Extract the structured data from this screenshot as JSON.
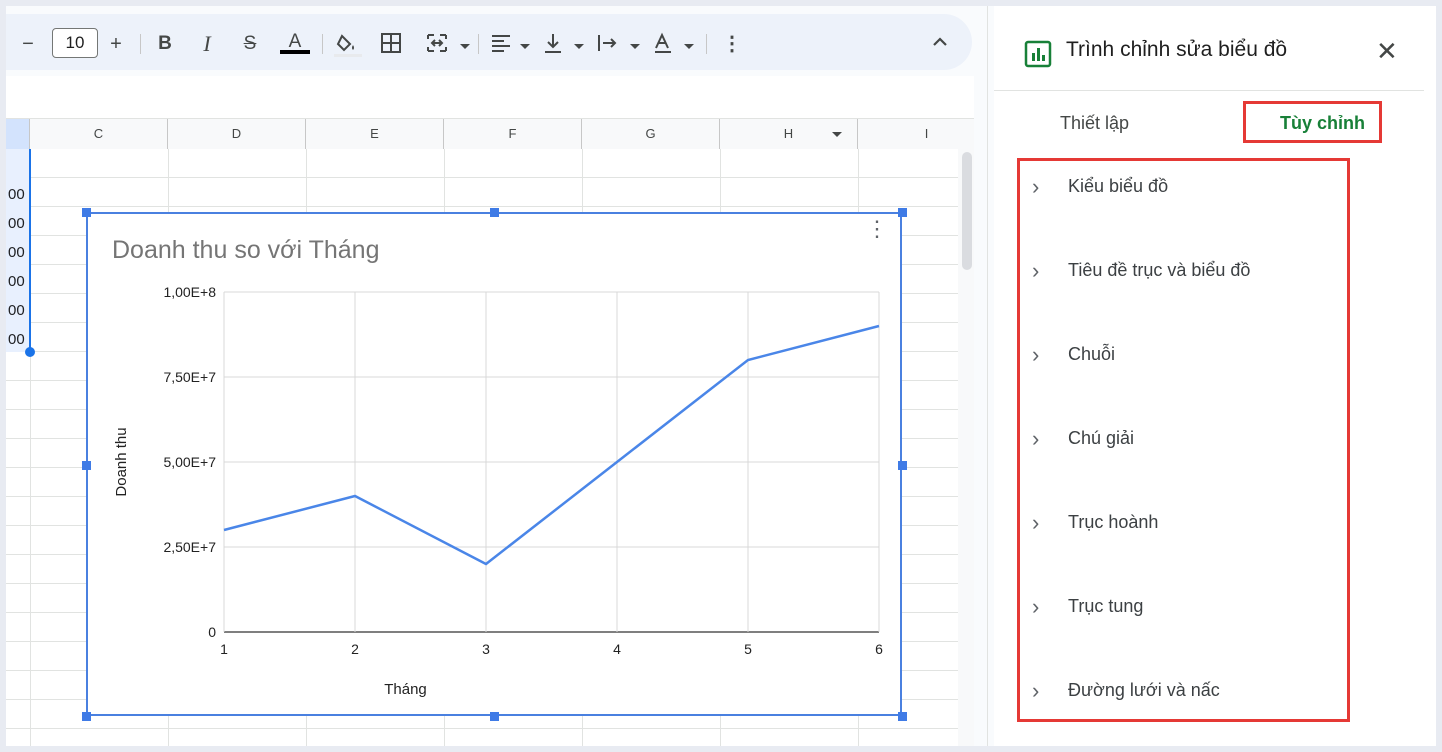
{
  "toolbar": {
    "font_size": "10",
    "decrease": "−",
    "increase": "+",
    "bold": "B",
    "italic": "I",
    "strike": "S",
    "text_color": "A",
    "more": "⋮",
    "collapse": "^"
  },
  "columns": [
    "C",
    "D",
    "E",
    "F",
    "G",
    "H",
    "I"
  ],
  "cell_values": [
    "00",
    "00",
    "00",
    "00",
    "00",
    "00"
  ],
  "chart_data": {
    "type": "line",
    "title": "Doanh thu  so với Tháng",
    "xlabel": "Tháng",
    "ylabel": "Doanh thu",
    "x": [
      1,
      2,
      3,
      4,
      5,
      6
    ],
    "x_tick_labels": [
      "1",
      "2",
      "3",
      "4",
      "5",
      "6"
    ],
    "y_tick_labels": [
      "0",
      "2,50E+7",
      "5,00E+7",
      "7,50E+7",
      "1,00E+8"
    ],
    "y_ticks": [
      0,
      25000000,
      50000000,
      75000000,
      100000000
    ],
    "ylim": [
      0,
      100000000
    ],
    "series": [
      {
        "values": [
          30000000,
          40000000,
          20000000,
          50000000,
          80000000,
          90000000
        ]
      }
    ],
    "line_color": "#4a86e8",
    "grid": true
  },
  "panel": {
    "title": "Trình chỉnh sửa biểu đồ",
    "close": "✕",
    "tabs": {
      "setup": "Thiết lập",
      "customize": "Tùy chỉnh"
    },
    "sections": [
      "Kiểu biểu đồ",
      "Tiêu đề trục và biểu đồ",
      "Chuỗi",
      "Chú giải",
      "Trục hoành",
      "Trục tung",
      "Đường lưới và nấc"
    ]
  },
  "colors": {
    "accent_green": "#188038",
    "highlight_red": "#e53935",
    "selection_blue": "#4a80e0"
  }
}
